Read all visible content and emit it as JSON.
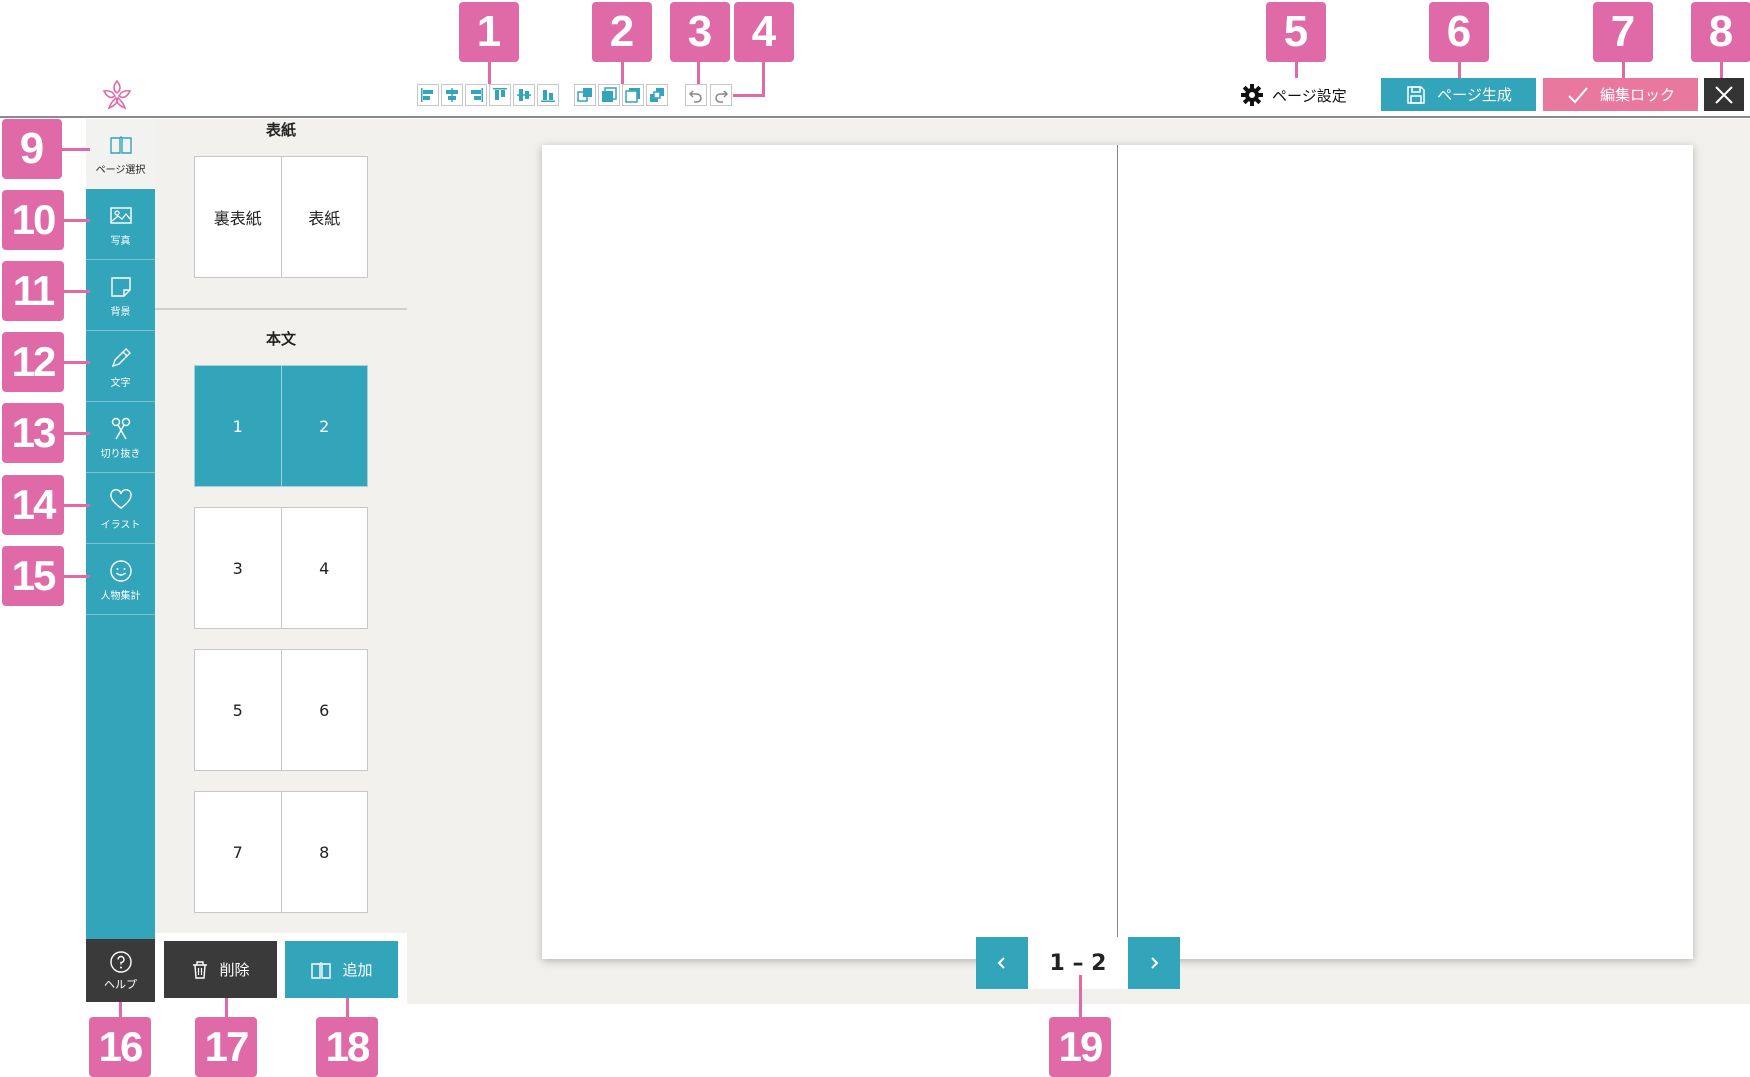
{
  "callouts": [
    "1",
    "2",
    "3",
    "4",
    "5",
    "6",
    "7",
    "8",
    "9",
    "10",
    "11",
    "12",
    "13",
    "14",
    "15",
    "16",
    "17",
    "18",
    "19"
  ],
  "toolbar": {
    "align_tools": [
      "align-left-icon",
      "align-center-icon",
      "align-right-icon",
      "align-top-icon",
      "align-middle-icon",
      "align-bottom-icon"
    ],
    "layer_tools": [
      "bring-front-icon",
      "bring-forward-icon",
      "send-backward-icon",
      "send-back-icon"
    ],
    "undo_icon": "undo-icon",
    "redo_icon": "redo-icon",
    "page_settings_label": "ページ設定",
    "generate_label": "ページ生成",
    "lock_label": "編集ロック"
  },
  "sidenav": {
    "items": [
      {
        "label": "ページ選択",
        "icon": "book-icon"
      },
      {
        "label": "写真",
        "icon": "photo-icon"
      },
      {
        "label": "背景",
        "icon": "background-icon"
      },
      {
        "label": "文字",
        "icon": "pencil-icon"
      },
      {
        "label": "切り抜き",
        "icon": "scissors-icon"
      },
      {
        "label": "イラスト",
        "icon": "heart-icon"
      },
      {
        "label": "人物集計",
        "icon": "smile-icon"
      }
    ],
    "help_label": "ヘルプ"
  },
  "panel": {
    "cover_heading": "表紙",
    "cover_pages": [
      "裏表紙",
      "表紙"
    ],
    "body_heading": "本文",
    "spreads": [
      [
        "1",
        "2"
      ],
      [
        "3",
        "4"
      ],
      [
        "5",
        "6"
      ],
      [
        "7",
        "8"
      ]
    ],
    "selected_spread": 0,
    "delete_label": "削除",
    "add_label": "追加"
  },
  "pager": {
    "current": "1 – 2"
  },
  "colors": {
    "accent": "#33a5bb",
    "lock": "#e9789e",
    "callout": "#e06aa8",
    "dark": "#3a3a3a"
  }
}
